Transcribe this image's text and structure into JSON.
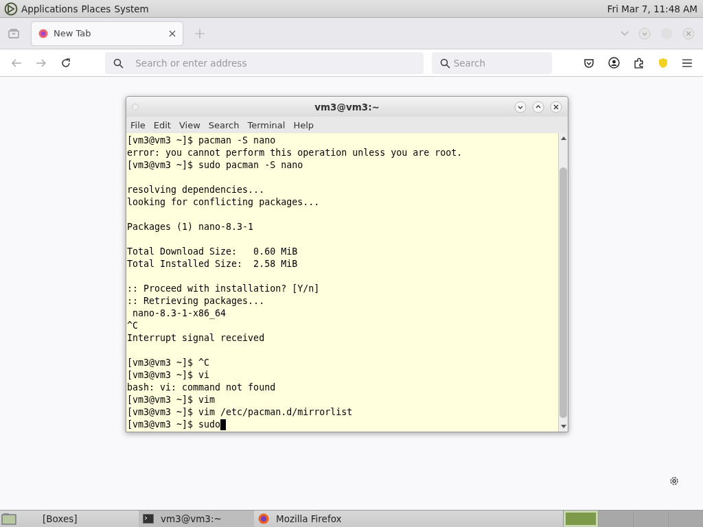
{
  "top_panel": {
    "menus": [
      "Applications",
      "Places",
      "System"
    ],
    "clock": "Fri Mar 7, 11:48 AM"
  },
  "browser": {
    "tabs": [
      {
        "label": "New Tab",
        "selected": true
      }
    ],
    "address": {
      "placeholder": "Search or enter address"
    },
    "search": {
      "placeholder": "Search"
    }
  },
  "terminal": {
    "title": "vm3@vm3:~",
    "menu": [
      "File",
      "Edit",
      "View",
      "Search",
      "Terminal",
      "Help"
    ],
    "blocks": [
      [
        "[vm3@vm3 ~]$ pacman -S nano",
        "error: you cannot perform this operation unless you are root.",
        "[vm3@vm3 ~]$ sudo pacman -S nano"
      ],
      [
        "resolving dependencies...",
        "looking for conflicting packages..."
      ],
      [
        "Packages (1) nano-8.3-1"
      ],
      [
        "Total Download Size:   0.60 MiB",
        "Total Installed Size:  2.58 MiB"
      ],
      [
        ":: Proceed with installation? [Y/n]",
        ":: Retrieving packages...",
        " nano-8.3-1-x86_64",
        "^C",
        "Interrupt signal received"
      ],
      [
        "[vm3@vm3 ~]$ ^C",
        "[vm3@vm3 ~]$ vi",
        "bash: vi: command not found",
        "[vm3@vm3 ~]$ vim",
        "[vm3@vm3 ~]$ vim /etc/pacman.d/mirrorlist",
        "[vm3@vm3 ~]$ sudo"
      ]
    ],
    "cursor": true
  },
  "taskbar": {
    "items": [
      {
        "label": "[Boxes]",
        "kind": "plain",
        "selected": false
      },
      {
        "label": "vm3@vm3:~",
        "kind": "terminal",
        "selected": true
      },
      {
        "label": "Mozilla Firefox",
        "kind": "firefox",
        "selected": false
      }
    ],
    "workspaces": [
      {
        "selected": true
      },
      {
        "selected": false
      },
      {
        "selected": false
      },
      {
        "selected": false
      }
    ]
  }
}
